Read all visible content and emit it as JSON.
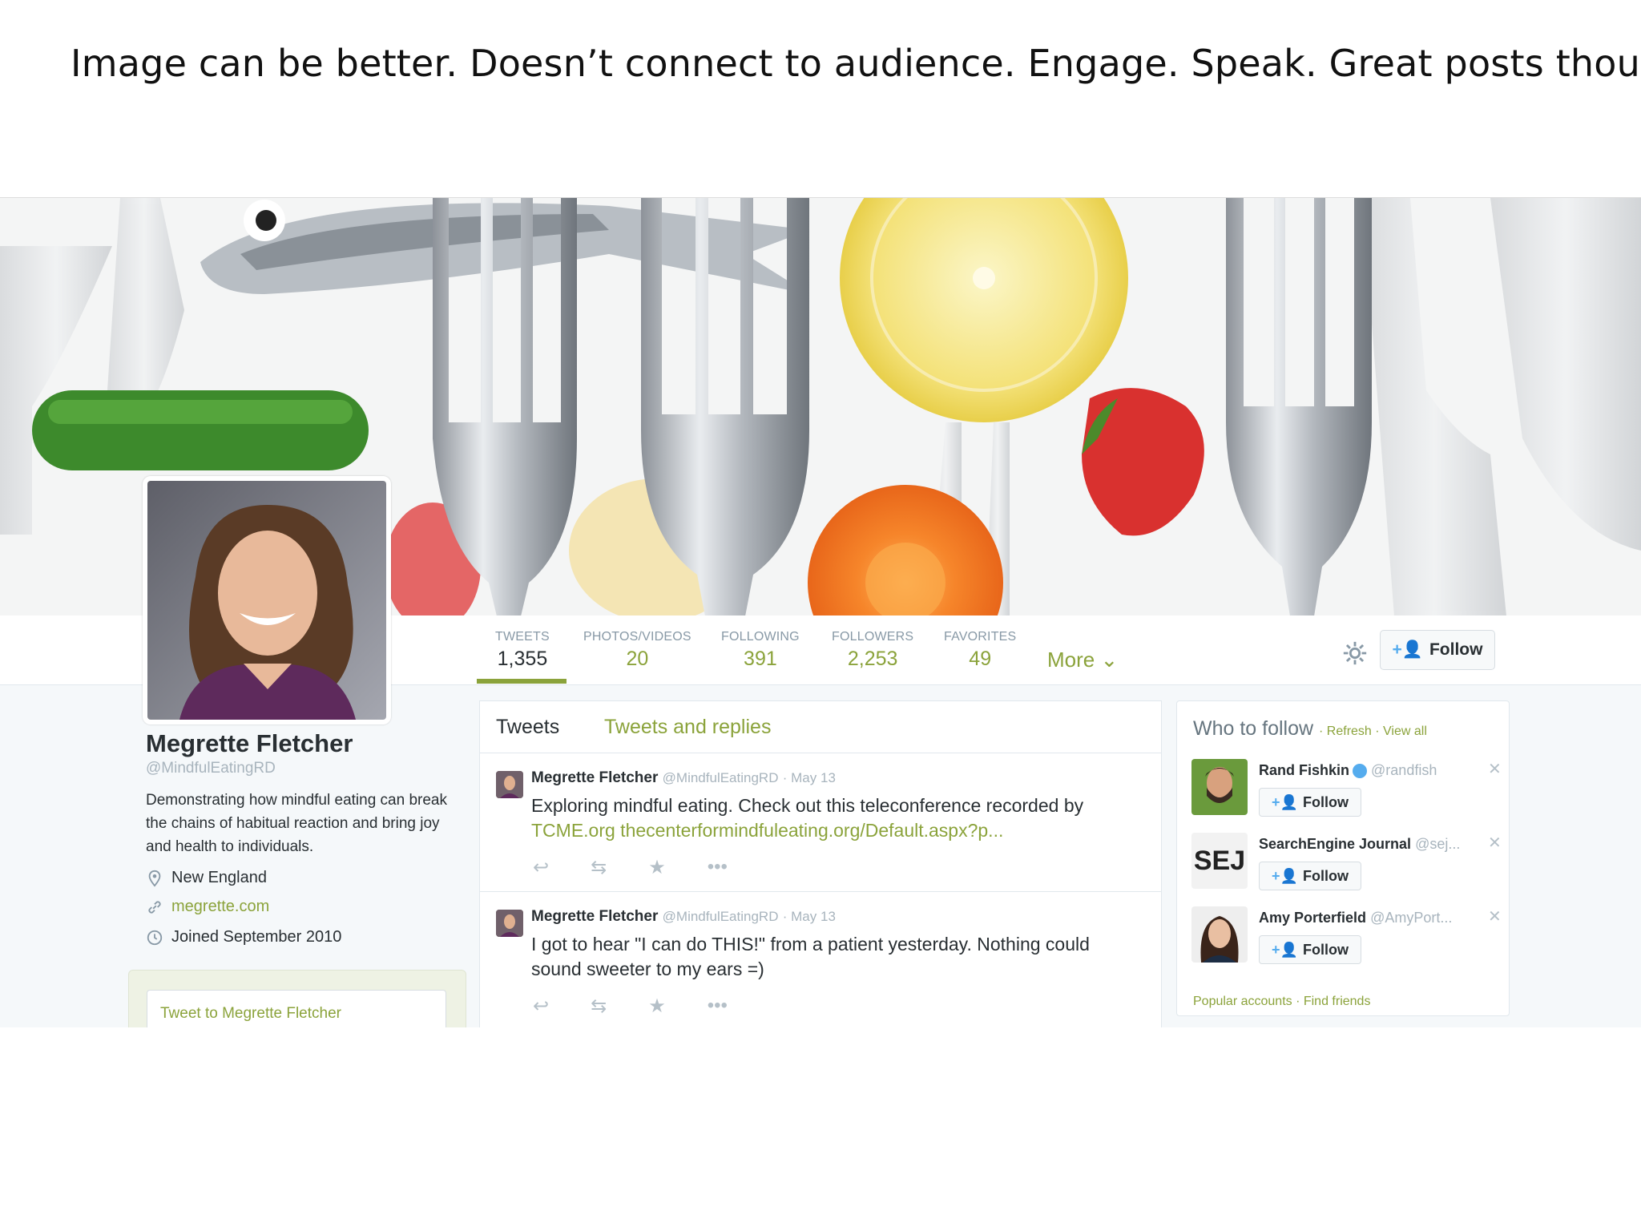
{
  "caption": "Image can be better.  Doesn’t connect to audience.  Engage.  Speak.  Great posts though!",
  "profile": {
    "name": "Megrette Fletcher",
    "handle": "@MindfulEatingRD",
    "bio": "Demonstrating how mindful eating can break the chains of habitual reaction and bring joy and health to individuals.",
    "location": "New England",
    "website": "megrette.com",
    "joined": "Joined September 2010",
    "tweet_to": "Tweet to Megrette Fletcher"
  },
  "stats": [
    {
      "label": "TWEETS",
      "value": "1,355"
    },
    {
      "label": "PHOTOS/VIDEOS",
      "value": "20"
    },
    {
      "label": "FOLLOWING",
      "value": "391"
    },
    {
      "label": "FOLLOWERS",
      "value": "2,253"
    },
    {
      "label": "FAVORITES",
      "value": "49"
    }
  ],
  "nav": {
    "more_label": "More",
    "follow_label": "Follow"
  },
  "timeline": {
    "tab_tweets": "Tweets",
    "tab_replies": "Tweets and replies",
    "tweets": [
      {
        "author": "Megrette Fletcher",
        "handle": "@MindfulEatingRD",
        "date": "· May 13",
        "text": "Exploring mindful eating. Check out this teleconference recorded by ",
        "link": "TCME.org thecenterformindfuleating.org/Default.aspx?p..."
      },
      {
        "author": "Megrette Fletcher",
        "handle": "@MindfulEatingRD",
        "date": "· May 13",
        "text": "I got to hear \"I can do THIS!\" from a patient yesterday.  Nothing could sound sweeter to my ears =)",
        "link": ""
      }
    ]
  },
  "who_to_follow": {
    "title": "Who to follow",
    "refresh": "· Refresh · View all",
    "suggestions": [
      {
        "name": "Rand Fishkin",
        "handle": "@randfish",
        "follow": "Follow"
      },
      {
        "name": "SearchEngine Journal",
        "handle": "@sej...",
        "follow": "Follow",
        "logo": "SEJ"
      },
      {
        "name": "Amy Porterfield",
        "handle": "@AmyPort...",
        "follow": "Follow"
      }
    ],
    "footer": "Popular accounts · Find friends"
  },
  "colors": {
    "accent": "#8ba33b",
    "text": "#292f33",
    "muted": "#8899a6"
  }
}
